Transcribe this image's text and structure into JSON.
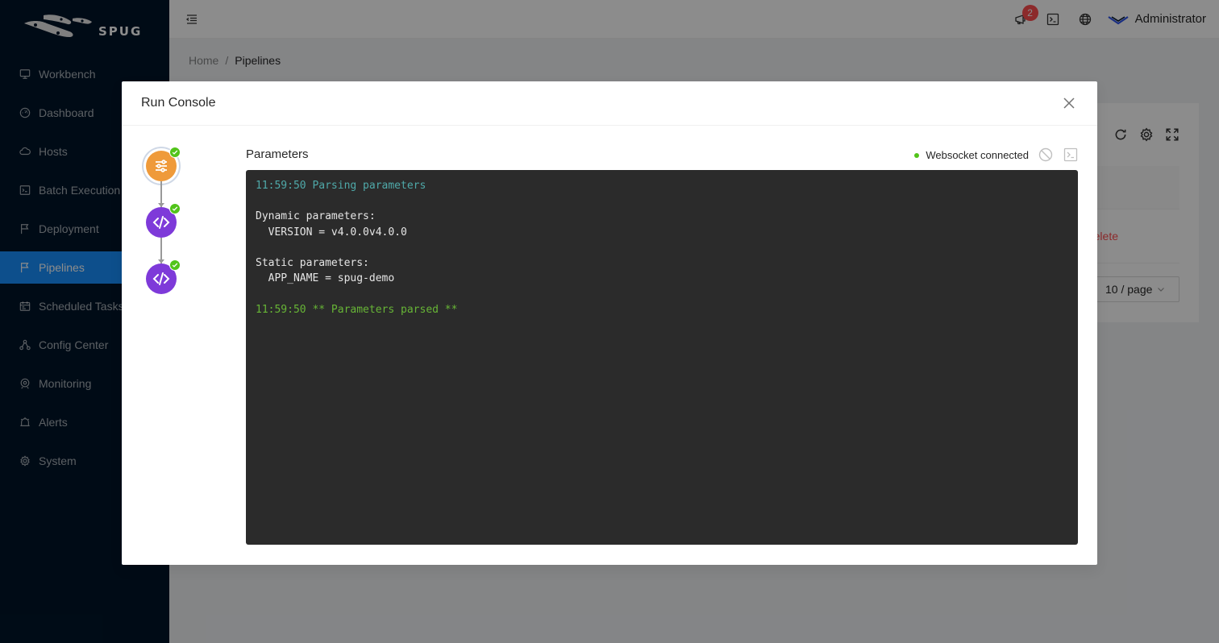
{
  "app": {
    "logo_text": "SPUG"
  },
  "sidebar": {
    "items": [
      {
        "label": "Workbench",
        "icon": "monitor-icon",
        "active": false
      },
      {
        "label": "Dashboard",
        "icon": "dashboard-icon",
        "active": false
      },
      {
        "label": "Hosts",
        "icon": "cloud-icon",
        "active": false
      },
      {
        "label": "Batch Execution",
        "icon": "code-icon",
        "active": false
      },
      {
        "label": "Deployment",
        "icon": "flag-icon",
        "active": false
      },
      {
        "label": "Pipelines",
        "icon": "flag-icon",
        "active": true
      },
      {
        "label": "Scheduled Tasks",
        "icon": "schedule-icon",
        "active": false
      },
      {
        "label": "Config Center",
        "icon": "apartment-icon",
        "active": false
      },
      {
        "label": "Monitoring",
        "icon": "radar-icon",
        "active": false
      },
      {
        "label": "Alerts",
        "icon": "alert-icon",
        "active": false
      },
      {
        "label": "System",
        "icon": "setting-icon",
        "active": false
      }
    ]
  },
  "header": {
    "notification_count": "2",
    "user_name": "Administrator"
  },
  "breadcrumb": {
    "home": "Home",
    "separator": "/",
    "current": "Pipelines"
  },
  "background": {
    "delete_label": "Delete",
    "page_size": "10 / page"
  },
  "modal": {
    "title": "Run Console",
    "panel_title": "Parameters",
    "ws_status": "Websocket connected",
    "steps": [
      {
        "icon": "parameters-icon",
        "status": "success"
      },
      {
        "icon": "code-icon",
        "status": "success"
      },
      {
        "icon": "code-icon",
        "status": "success"
      }
    ],
    "terminal": {
      "line1": "11:59:50 Parsing parameters",
      "line2": "",
      "line3": "Dynamic parameters:",
      "line4": "  VERSION = v4.0.0v4.0.0",
      "line5": "",
      "line6": "Static parameters:",
      "line7": "  APP_NAME = spug-demo",
      "line8": "",
      "line9": "11:59:50 ** Parameters parsed **"
    }
  },
  "colors": {
    "sidebar_bg": "#001529",
    "active_item": "#1890ff",
    "step_orange": "#ef9a3a",
    "step_purple": "#7e3ad9",
    "success": "#52c41a",
    "terminal_bg": "#2b2b2b",
    "terminal_cyan": "#4fa9a9",
    "terminal_green": "#67b536"
  }
}
